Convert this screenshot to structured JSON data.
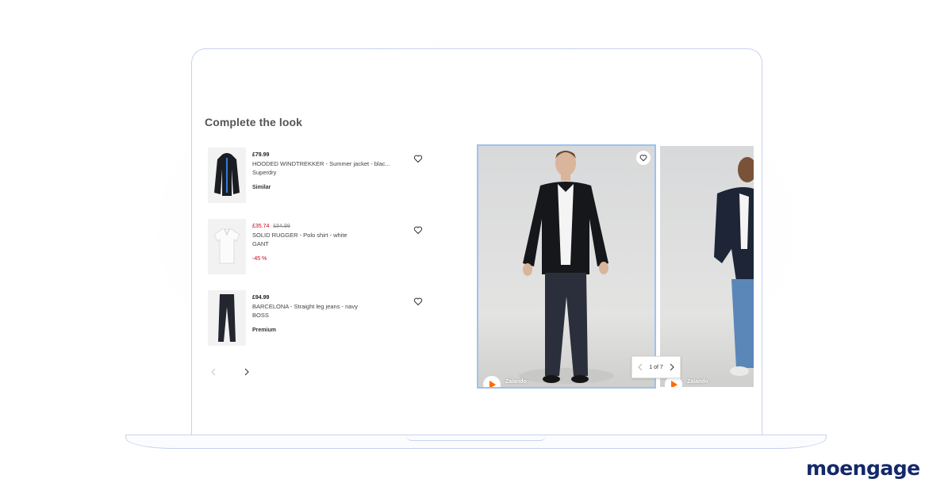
{
  "section": {
    "title": "Complete the look"
  },
  "products": [
    {
      "price": "£79.99",
      "old_price": "",
      "name": "HOODED WINDTREKKER - Summer jacket - blac...",
      "brand": "Superdry",
      "tag": "Similar",
      "tag_type": "label",
      "item": "jacket"
    },
    {
      "price": "£35.74",
      "old_price": "£64.99",
      "name": "SOLID RUGGER - Polo shirt - white",
      "brand": "GANT",
      "tag": "-45 %",
      "tag_type": "discount",
      "item": "polo"
    },
    {
      "price": "£94.99",
      "old_price": "",
      "name": "BARCELONA - Straight leg jeans - navy",
      "brand": "BOSS",
      "tag": "Premium",
      "tag_type": "label",
      "item": "jeans"
    }
  ],
  "cards": [
    {
      "brand": "Zalando"
    },
    {
      "brand": "Zalando"
    }
  ],
  "carousel": {
    "pager_text": "1 of 7"
  },
  "logo": {
    "text": "moengage"
  },
  "colors": {
    "sale_red": "#d0021b",
    "active_border": "#9cc3f0",
    "logo_navy": "#14286b",
    "badge_orange": "#ff6a00"
  }
}
